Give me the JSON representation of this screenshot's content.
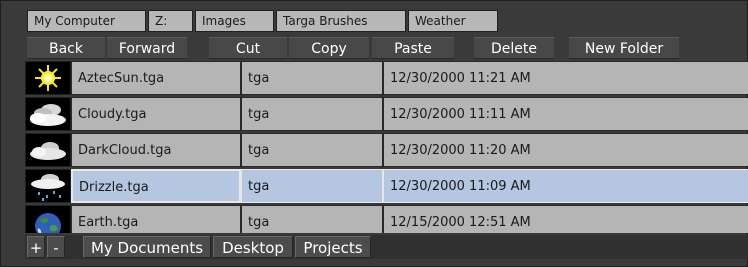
{
  "breadcrumb": [
    "My Computer",
    "Z:",
    "Images",
    "Targa Brushes",
    "Weather"
  ],
  "toolbar": {
    "back": "Back",
    "forward": "Forward",
    "cut": "Cut",
    "copy": "Copy",
    "paste": "Paste",
    "delete": "Delete",
    "new_folder": "New Folder"
  },
  "files": [
    {
      "name": "AztecSun.tga",
      "type": "tga",
      "date": "12/30/2000 11:21 AM",
      "icon": "sun-icon",
      "selected": false
    },
    {
      "name": "Cloudy.tga",
      "type": "tga",
      "date": "12/30/2000 11:11 AM",
      "icon": "cloudy-icon",
      "selected": false
    },
    {
      "name": "DarkCloud.tga",
      "type": "tga",
      "date": "12/30/2000 11:20 AM",
      "icon": "dark-cloud-icon",
      "selected": false
    },
    {
      "name": "Drizzle.tga",
      "type": "tga",
      "date": "12/30/2000 11:09 AM",
      "icon": "drizzle-icon",
      "selected": true
    },
    {
      "name": "Earth.tga",
      "type": "tga",
      "date": "12/15/2000 12:51 AM",
      "icon": "earth-icon",
      "selected": false
    }
  ],
  "bottom": {
    "add": "+",
    "remove": "-",
    "places": [
      "My Documents",
      "Desktop",
      "Projects"
    ]
  },
  "colors": {
    "background": "#3a3a3a",
    "cell": "#b5b5b5",
    "selected": "#b4c6e0",
    "button": "#484848"
  }
}
